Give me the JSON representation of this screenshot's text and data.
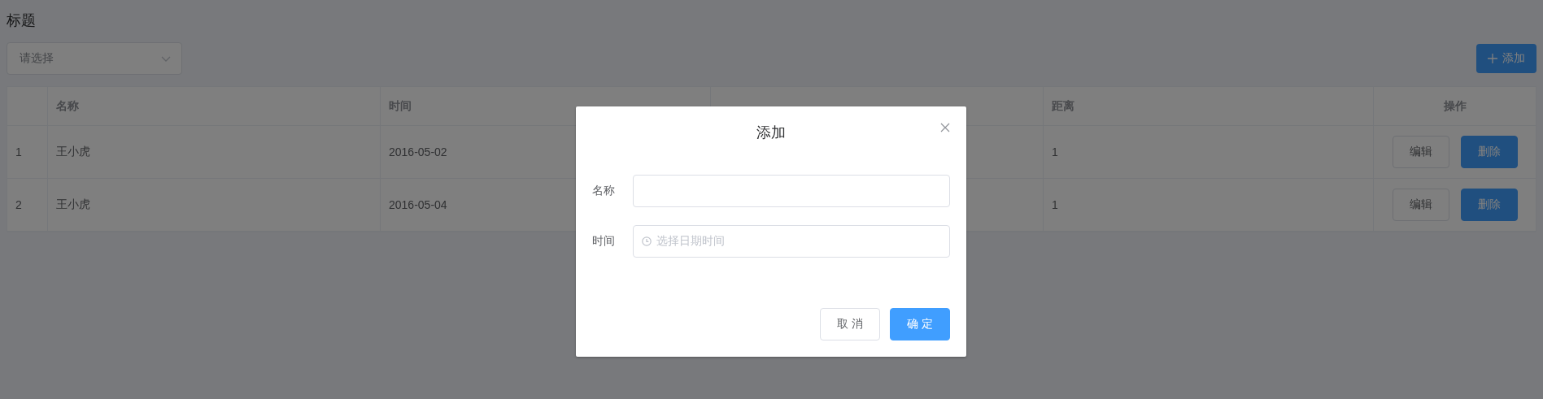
{
  "page": {
    "title": "标题"
  },
  "toolbar": {
    "select": {
      "placeholder": "请选择"
    },
    "add_button": {
      "label": "添加"
    }
  },
  "table": {
    "columns": [
      "名称",
      "时间",
      "距离",
      "操作"
    ],
    "rows": [
      {
        "index": "1",
        "name": "王小虎",
        "time": "2016-05-02",
        "distance": "1",
        "actions": [
          {
            "label": "编辑",
            "kind": "default"
          },
          {
            "label": "删除",
            "kind": "primary"
          }
        ]
      },
      {
        "index": "2",
        "name": "王小虎",
        "time": "2016-05-04",
        "distance": "1",
        "actions": [
          {
            "label": "编辑",
            "kind": "default"
          },
          {
            "label": "删除",
            "kind": "primary"
          }
        ]
      }
    ]
  },
  "dialog": {
    "title": "添加",
    "fields": [
      {
        "label": "名称",
        "kind": "text"
      },
      {
        "label": "时间",
        "kind": "datetime",
        "placeholder": "选择日期时间"
      }
    ],
    "buttons": [
      {
        "label": "取 消",
        "kind": "default"
      },
      {
        "label": "确 定",
        "kind": "primary"
      }
    ]
  }
}
